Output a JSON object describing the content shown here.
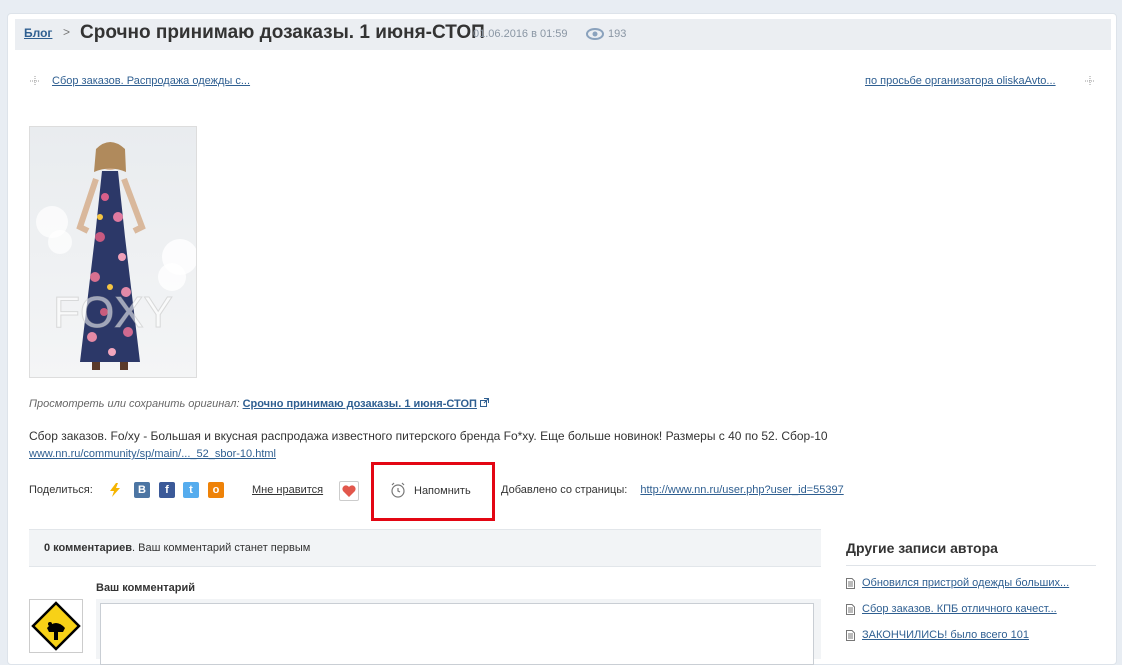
{
  "breadcrumb": {
    "blog": "Блог",
    "separator": ">"
  },
  "post": {
    "title": "Срочно принимаю дозаказы. 1 июня-СТОП",
    "date": "01.06.2016 в 01:59",
    "views": "193"
  },
  "nav": {
    "prev": "Сбор заказов. Распродажа одежды с...",
    "next": "по просьбе организатора oliskaAvto..."
  },
  "photo": {
    "watermark": "FOXY"
  },
  "original": {
    "prefix": "Просмотреть или сохранить оригинал:",
    "link": "Срочно принимаю дозаказы. 1 июня-СТОП"
  },
  "description": {
    "text": "Сбор заказов. Fo/xy - Большая и вкусная распродажа известного питерского бренда Fo*xy. Еще больше новинок! Размеры с 40 по 52. Сбор-10",
    "link": "www.nn.ru/community/sp/main/..._52_sbor-10.html"
  },
  "actions": {
    "share_label": "Поделиться:",
    "share_icons": [
      "lightning-icon",
      "vk-icon",
      "facebook-icon",
      "twitter-icon",
      "odnoklassniki-icon"
    ],
    "like_label": "Мне нравится",
    "remind_label": "Напомнить",
    "added_label": "Добавлено со страницы:",
    "added_link": "http://www.nn.ru/user.php?user_id=55397"
  },
  "comments": {
    "count": "0 комментариев",
    "note": ". Ваш комментарий станет первым",
    "your_comment_label": "Ваш комментарий"
  },
  "other_posts": {
    "title": "Другие записи автора",
    "items": [
      "Обновился пристрой одежды больших...",
      "Сбор заказов. КПБ отличного качест...",
      "ЗАКОНЧИЛИСЬ! было всего 101"
    ]
  },
  "colors": {
    "link": "#2f5f91",
    "highlight": "#e30613",
    "vk": "#4c75a3",
    "facebook": "#3b5998",
    "twitter": "#55acee",
    "ok": "#ee8208"
  }
}
